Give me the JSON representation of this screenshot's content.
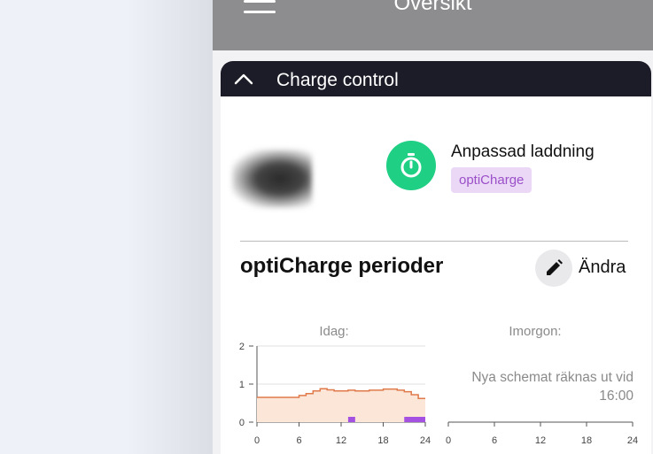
{
  "topbar": {
    "title": "Översikt"
  },
  "charge_control": {
    "title": "Charge control",
    "mode_title": "Anpassad laddning",
    "mode_badge": "optiCharge",
    "mode_color": "#1fcf84",
    "badge_color": "#9b4fc8"
  },
  "periods": {
    "title": "optiCharge perioder",
    "edit_label": "Ändra"
  },
  "today": {
    "title": "Idag:"
  },
  "tomorrow": {
    "title": "Imorgon:",
    "message_line1": "Nya schemat räknas ut vid",
    "message_line2": "16:00"
  },
  "chart_data": [
    {
      "type": "line",
      "title": "Idag:",
      "x_ticks": [
        "0",
        "6",
        "12",
        "18",
        "24"
      ],
      "y_ticks": [
        "0",
        "1",
        "2"
      ],
      "xlim": [
        0,
        24
      ],
      "ylim": [
        0,
        2
      ],
      "series": [
        {
          "color": "#e07a4a",
          "step": true,
          "x": [
            0,
            1,
            2,
            3,
            4,
            5,
            6,
            7,
            8,
            9,
            10,
            11,
            12,
            13,
            14,
            15,
            16,
            17,
            18,
            19,
            20,
            21,
            22,
            23
          ],
          "y": [
            0.65,
            0.65,
            0.65,
            0.65,
            0.65,
            0.65,
            0.7,
            0.75,
            0.82,
            0.88,
            0.85,
            0.82,
            0.82,
            0.84,
            0.82,
            0.82,
            0.84,
            0.84,
            0.87,
            0.87,
            0.84,
            0.8,
            0.72,
            0.62
          ]
        }
      ],
      "charge_periods": [
        [
          13,
          14
        ],
        [
          21,
          24
        ]
      ],
      "charge_color": "#a450e0"
    },
    {
      "type": "line",
      "title": "Imorgon:",
      "x_ticks": [
        "0",
        "6",
        "12",
        "18",
        "24"
      ],
      "xlim": [
        0,
        24
      ],
      "series": []
    }
  ]
}
